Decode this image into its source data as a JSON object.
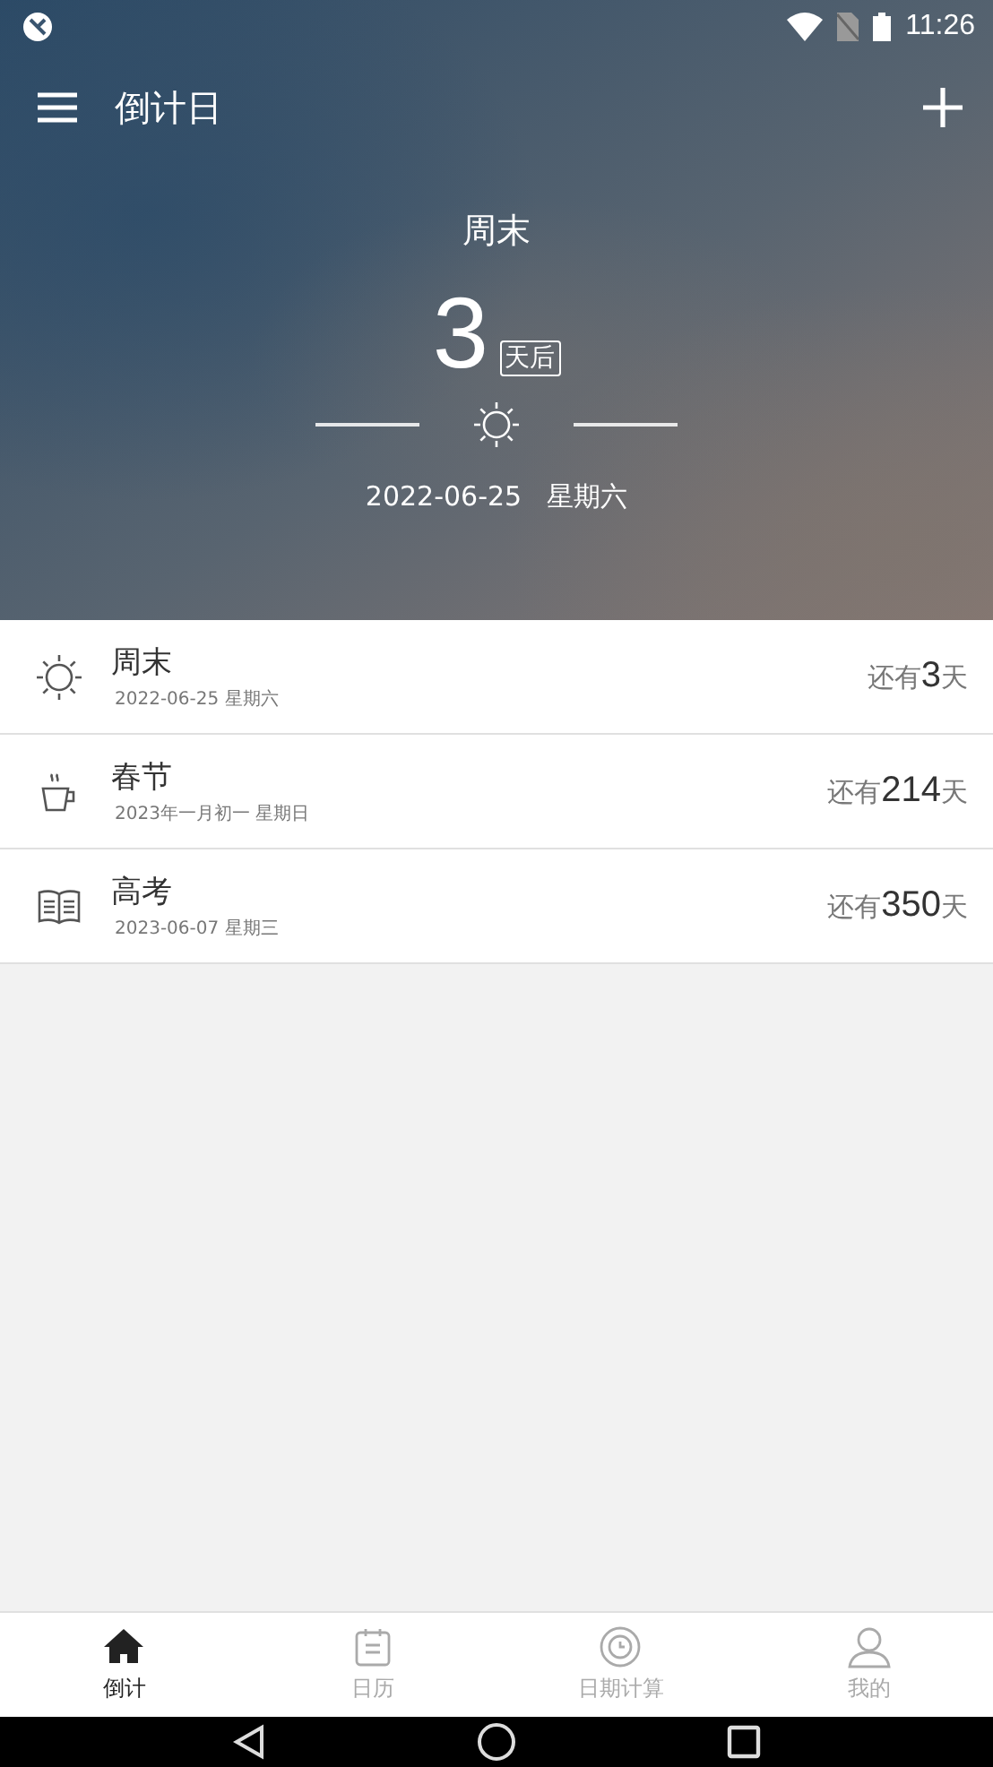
{
  "status_bar": {
    "time": "11:26"
  },
  "toolbar": {
    "title": "倒计日"
  },
  "hero": {
    "title": "周末",
    "count": "3",
    "unit": "天后",
    "kind": "sun",
    "date": "2022-06-25",
    "weekday": "星期六"
  },
  "events": [
    {
      "kind": "sun",
      "name": "周末",
      "date": "2022-06-25 星期六",
      "prefix": "还有",
      "count": "3",
      "unit": "天"
    },
    {
      "kind": "cup",
      "name": "春节",
      "date": "2023年一月初一 星期日",
      "prefix": "还有",
      "count": "214",
      "unit": "天"
    },
    {
      "kind": "book",
      "name": "高考",
      "date": "2023-06-07 星期三",
      "prefix": "还有",
      "count": "350",
      "unit": "天"
    }
  ],
  "tabs": [
    {
      "kind": "home",
      "label": "倒计",
      "selected": true
    },
    {
      "kind": "calendar",
      "label": "日历",
      "selected": false
    },
    {
      "kind": "clock",
      "label": "日期计算",
      "selected": false
    },
    {
      "kind": "person",
      "label": "我的",
      "selected": false
    }
  ]
}
